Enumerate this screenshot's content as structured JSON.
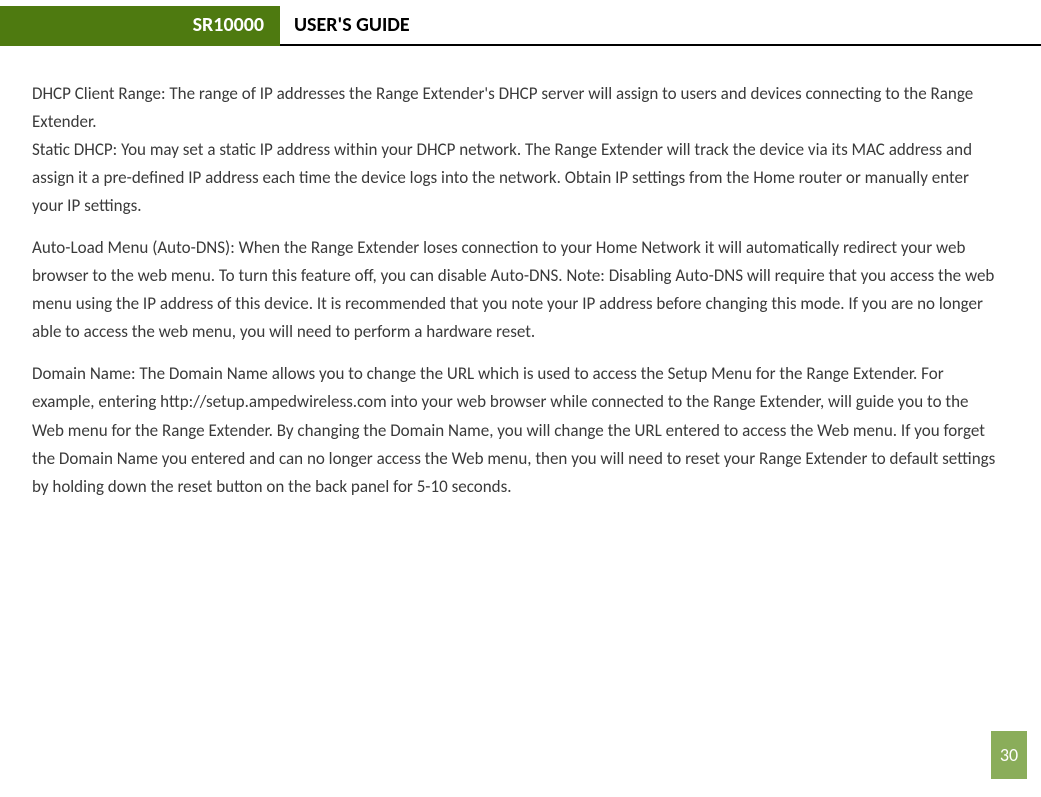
{
  "header": {
    "model": "SR10000",
    "title": "USER'S GUIDE"
  },
  "body": {
    "p1": "DHCP Client Range: The range of IP addresses the Range Extender's DHCP server will assign to users and devices connecting to the Range Extender.\nStatic DHCP: You may set a static IP address within your DHCP network.  The Range Extender will track the device via its MAC address and assign it a pre-defined IP address each time the device logs into the network. Obtain IP settings from the Home router or manually enter your IP settings.",
    "p2": "Auto-Load Menu (Auto-DNS): When the Range Extender loses connection to your Home Network it will automatically redirect your web browser to the web menu. To turn this feature off, you can disable Auto-DNS. Note: Disabling Auto-DNS will require that you access the web menu using the IP address of this device. It is recommended that you note your IP address before changing this mode. If you are no longer able to access the web menu, you will need to perform a hardware reset.",
    "p3": "Domain Name: The Domain Name allows you to change the URL which is used to access the Setup Menu for the Range Extender.  For example, entering http://setup.ampedwireless.com into your web browser while connected to the Range Extender, will guide you to the Web menu for the Range Extender.  By changing the Domain Name, you will change the URL entered to access the Web menu.  If you forget the Domain Name you entered and can no longer access the Web menu, then you will need to reset your Range Extender to default settings by holding down the reset button on the back panel for 5-10 seconds."
  },
  "page_number": "30"
}
